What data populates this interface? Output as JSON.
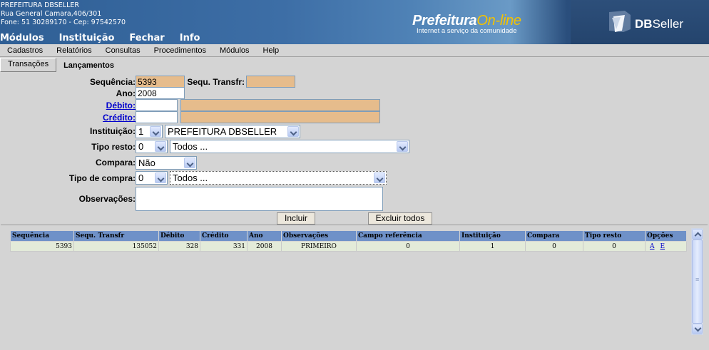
{
  "header": {
    "org_name": "PREFEITURA DBSELLER",
    "address": "Rua General Camara,406/301",
    "phone": "Fone: 51 30289170  -  Cep: 97542570",
    "brand_main": "Prefeitura",
    "brand_accent": "On-line",
    "brand_sub": "Internet a serviço da comunidade",
    "vendor_bold": "DB",
    "vendor_rest": "Seller"
  },
  "topmenu": [
    "Módulos",
    "Instituição",
    "Fechar",
    "Info"
  ],
  "menubar": [
    "Cadastros",
    "Relatórios",
    "Consultas",
    "Procedimentos",
    "Módulos",
    "Help"
  ],
  "tabs": {
    "transacoes": "Transações",
    "lancamentos": "Lançamentos"
  },
  "form": {
    "sequencia_label": "Sequência:",
    "sequencia_value": "5393",
    "sequ_transfr_label": "Sequ. Transfr:",
    "sequ_transfr_value": "",
    "ano_label": "Ano:",
    "ano_value": "2008",
    "debito_label": "Débito:",
    "debito_value": "",
    "debito_desc": "",
    "credito_label": "Crédito:",
    "credito_value": "",
    "credito_desc": "",
    "instituicao_label": "Instituição:",
    "instituicao_code": "1",
    "instituicao_name": "PREFEITURA DBSELLER",
    "tipo_resto_label": "Tipo resto:",
    "tipo_resto_code": "0",
    "tipo_resto_desc": "Todos ...",
    "compara_label": "Compara:",
    "compara_value": "Não",
    "tipo_compra_label": "Tipo de compra:",
    "tipo_compra_code": "0",
    "tipo_compra_desc": "Todos ...",
    "observacoes_label": "Observações:",
    "observacoes_value": "",
    "incluir_button": "Incluir",
    "excluir_button": "Excluir todos"
  },
  "grid": {
    "columns": [
      "Sequência",
      "Sequ. Transfr",
      "Débito",
      "Crédito",
      "Ano",
      "Observações",
      "Campo referência",
      "Instituição",
      "Compara",
      "Tipo resto",
      "Opções"
    ],
    "rows": [
      {
        "sequencia": "5393",
        "sequ_transfr": "135052",
        "debito": "328",
        "credito": "331",
        "ano": "2008",
        "observacoes": "PRIMEIRO",
        "campo_referencia": "0",
        "instituicao": "1",
        "compara": "0",
        "tipo_resto": "0",
        "opt_a": "A",
        "opt_e": "E"
      }
    ]
  },
  "icons": [
    "chevron-down-icon",
    "scroll-up-icon",
    "scroll-down-icon",
    "dbseller-logo-icon"
  ],
  "colors": {
    "readonly_field": "#e6bc8c",
    "grid_header": "#6f91c8",
    "grid_row": "#e3ebd9",
    "link": "#0000cc"
  }
}
